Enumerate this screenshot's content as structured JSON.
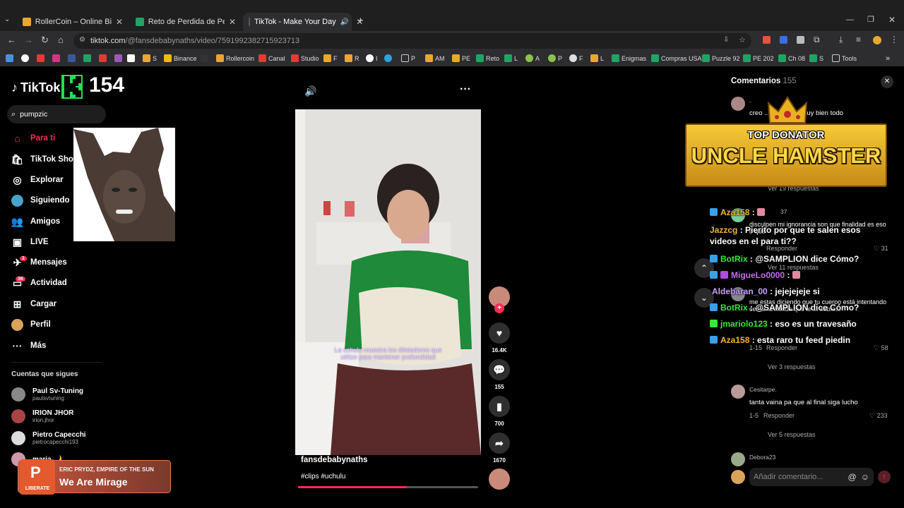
{
  "browser": {
    "tabs": [
      {
        "title": "RollerCoin – Online Bitcoin Mi"
      },
      {
        "title": "Reto de Perdida de Peso - El M"
      },
      {
        "title": "TikTok - Make Your Day"
      }
    ],
    "url_host": "tiktok.com",
    "url_path": "/@fansdebabynaths/video/7591992382715923713",
    "bookmarks": [
      "S",
      "Binance",
      "Rollercoin",
      "Canal",
      "Studio",
      "F",
      "R",
      "I",
      "P",
      "AM",
      "PE",
      "Reto",
      "L",
      "A",
      "P",
      "F",
      "L",
      "Enigmas",
      "Compras USA",
      "Puzzle 92",
      "PE 202",
      "Ch 08",
      "S",
      "Tools"
    ]
  },
  "overlay": {
    "counter": "154"
  },
  "sidebar": {
    "logo": "TikTok",
    "search_value": "pumpzic",
    "nav": [
      {
        "label": "Para ti"
      },
      {
        "label": "TikTok Shop"
      },
      {
        "label": "Explorar"
      },
      {
        "label": "Siguiendo"
      },
      {
        "label": "Amigos"
      },
      {
        "label": "LIVE"
      },
      {
        "label": "Mensajes",
        "badge": "1"
      },
      {
        "label": "Actividad",
        "badge": "36"
      },
      {
        "label": "Cargar"
      },
      {
        "label": "Perfil"
      },
      {
        "label": "Más"
      }
    ],
    "following_title": "Cuentas que sigues",
    "following": [
      {
        "name": "Paul Sv-Tuning",
        "handle": "paulsvtuning"
      },
      {
        "name": "IRION JHOR",
        "handle": "irion.jhor"
      },
      {
        "name": "Pietro Capecchi",
        "handle": "pietrocapecchi193"
      },
      {
        "name": "maria 🌙",
        "handle": ""
      }
    ]
  },
  "music": {
    "artist": "ERIC PRYDZ, EMPIRE OF THE SUN",
    "title": "We Are Mirage",
    "logo_text": "LIBERATE"
  },
  "video": {
    "caption_line1": "La uchulu muestra los dilatadores que",
    "caption_line2": "utilize para mantener profundidad",
    "author": "fansdebabynaths",
    "tags": "#clips #uchulu",
    "progress": 0.6,
    "likes": "16.4K",
    "comments": "155",
    "saves": "700",
    "shares": "1670"
  },
  "comments": {
    "header": "Comentarios",
    "count": "155",
    "input_placeholder": "Añadir comentario...",
    "donator_top": "TOP DONATOR",
    "donator_name": "UNCLE HAMSTER",
    "items": [
      {
        "name": "-",
        "text": "creo ... peto esta muy bien todo"
      },
      {
        "name": "",
        "text": "Ver 19 respuestas"
      },
      {
        "name": "37",
        "text": "disculpen mi ignorancia son que finalidad es eso o que"
      },
      {
        "name": "",
        "text": "Responder",
        "likes": "31"
      },
      {
        "name": "",
        "text": "Ver 11 respuestas"
      },
      {
        "name": "",
        "text": "me estas diciendo que tu cuerpo está intentando cerrar la herida que le ... sabía..."
      },
      {
        "name": "",
        "text": "1-15",
        "reply": "Responder",
        "likes": "58"
      },
      {
        "name": "",
        "text": "Ver 3 respuestas"
      },
      {
        "name": "Cesitarpe.",
        "text": "tanta vaina pa que al final siga lucho",
        "date": "1-5",
        "reply": "Responder",
        "likes": "233"
      },
      {
        "name": "",
        "text": "Ver 5 respuestas"
      },
      {
        "name": "Debora23",
        "text": ""
      }
    ]
  },
  "chat": [
    {
      "user": "Aza158",
      "msg": "",
      "color": "#f2b53a"
    },
    {
      "user": "Jazzcg",
      "msg": "Pierito por que te salen esos videos en el para ti??",
      "color": "#f2b53a"
    },
    {
      "user": "BotRix",
      "msg": "@SAMPLION dice Cómo?",
      "color": "#38e838"
    },
    {
      "user": "MigueLo0000",
      "msg": "",
      "color": "#c96cf0"
    },
    {
      "user": "Aldebaran_00",
      "msg": "jejejejeje si",
      "color": "#c9a2ff"
    },
    {
      "user": "BotRix",
      "msg": "@SAMPLION dice Cómo?",
      "color": "#38e838"
    },
    {
      "user": "jmariolo123",
      "msg": "eso es un travesaño",
      "color": "#38e838"
    },
    {
      "user": "Aza158",
      "msg": "esta raro tu feed piedin",
      "color": "#f2b53a"
    }
  ]
}
